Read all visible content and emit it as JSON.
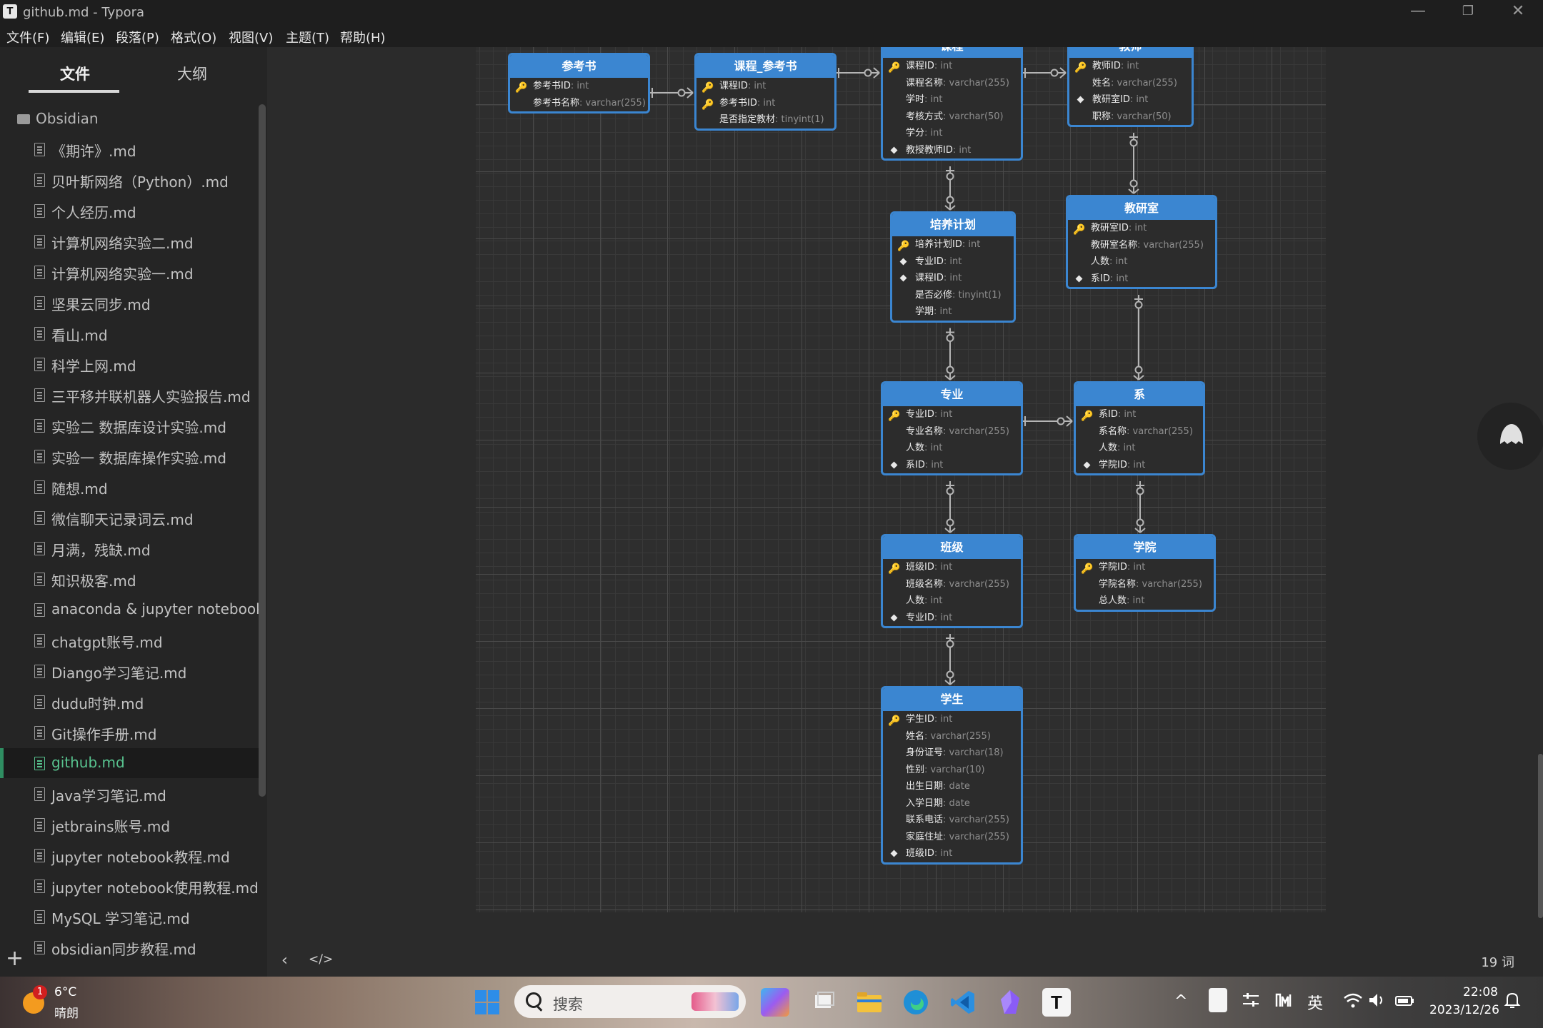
{
  "window": {
    "title": "github.md - Typora",
    "app_icon": "T",
    "minimize": "—",
    "restore": "❐",
    "close": "✕"
  },
  "menu": [
    "文件(F)",
    "编辑(E)",
    "段落(P)",
    "格式(O)",
    "视图(V)",
    "主题(T)",
    "帮助(H)"
  ],
  "sidebar": {
    "tabs": {
      "files": "文件",
      "outline": "大纲"
    },
    "folder": "Obsidian",
    "files": [
      "《期许》.md",
      "贝叶斯网络（Python）.md",
      "个人经历.md",
      "计算机网络实验二.md",
      "计算机网络实验一.md",
      "坚果云同步.md",
      "看山.md",
      "科学上网.md",
      "三平移并联机器人实验报告.md",
      "实验二 数据库设计实验.md",
      "实验一 数据库操作实验.md",
      "随想.md",
      "微信聊天记录词云.md",
      "月满，残缺.md",
      "知识极客.md",
      "anaconda & jupyter notebook",
      "chatgpt账号.md",
      "Diango学习笔记.md",
      "dudu时钟.md",
      "Git操作手册.md",
      "github.md",
      "Java学习笔记.md",
      "jetbrains账号.md",
      "jupyter notebook教程.md",
      "jupyter notebook使用教程.md",
      "MySQL 学习笔记.md",
      "obsidian同步教程.md"
    ],
    "active_file": "github.md",
    "add_button": "+"
  },
  "diagram": {
    "entities": [
      {
        "id": "reference-book",
        "title": "参考书",
        "attrs": [
          {
            "name": "参考书ID",
            "type": "int",
            "key": "pk"
          },
          {
            "name": "参考书名称",
            "type": "varchar(255)",
            "key": ""
          }
        ]
      },
      {
        "id": "course-reference",
        "title": "课程_参考书",
        "attrs": [
          {
            "name": "课程ID",
            "type": "int",
            "key": "pk"
          },
          {
            "name": "参考书ID",
            "type": "int",
            "key": "pk"
          },
          {
            "name": "是否指定教材",
            "type": "tinyint(1)",
            "key": ""
          }
        ]
      },
      {
        "id": "course",
        "title": "课程",
        "attrs": [
          {
            "name": "课程ID",
            "type": "int",
            "key": "pk"
          },
          {
            "name": "课程名称",
            "type": "varchar(255)",
            "key": ""
          },
          {
            "name": "学时",
            "type": "int",
            "key": ""
          },
          {
            "name": "考核方式",
            "type": "varchar(50)",
            "key": ""
          },
          {
            "name": "学分",
            "type": "int",
            "key": ""
          },
          {
            "name": "教授教师ID",
            "type": "int",
            "key": "fk"
          }
        ]
      },
      {
        "id": "teacher",
        "title": "教师",
        "attrs": [
          {
            "name": "教师ID",
            "type": "int",
            "key": "pk"
          },
          {
            "name": "姓名",
            "type": "varchar(255)",
            "key": ""
          },
          {
            "name": "教研室ID",
            "type": "int",
            "key": "fk"
          },
          {
            "name": "职称",
            "type": "varchar(50)",
            "key": ""
          }
        ]
      },
      {
        "id": "training-plan",
        "title": "培养计划",
        "attrs": [
          {
            "name": "培养计划ID",
            "type": "int",
            "key": "pk"
          },
          {
            "name": "专业ID",
            "type": "int",
            "key": "fk"
          },
          {
            "name": "课程ID",
            "type": "int",
            "key": "fk"
          },
          {
            "name": "是否必修",
            "type": "tinyint(1)",
            "key": ""
          },
          {
            "name": "学期",
            "type": "int",
            "key": ""
          }
        ]
      },
      {
        "id": "teaching-office",
        "title": "教研室",
        "attrs": [
          {
            "name": "教研室ID",
            "type": "int",
            "key": "pk"
          },
          {
            "name": "教研室名称",
            "type": "varchar(255)",
            "key": ""
          },
          {
            "name": "人数",
            "type": "int",
            "key": ""
          },
          {
            "name": "系ID",
            "type": "int",
            "key": "fk"
          }
        ]
      },
      {
        "id": "major",
        "title": "专业",
        "attrs": [
          {
            "name": "专业ID",
            "type": "int",
            "key": "pk"
          },
          {
            "name": "专业名称",
            "type": "varchar(255)",
            "key": ""
          },
          {
            "name": "人数",
            "type": "int",
            "key": ""
          },
          {
            "name": "系ID",
            "type": "int",
            "key": "fk"
          }
        ]
      },
      {
        "id": "department",
        "title": "系",
        "attrs": [
          {
            "name": "系ID",
            "type": "int",
            "key": "pk"
          },
          {
            "name": "系名称",
            "type": "varchar(255)",
            "key": ""
          },
          {
            "name": "人数",
            "type": "int",
            "key": ""
          },
          {
            "name": "学院ID",
            "type": "int",
            "key": "fk"
          }
        ]
      },
      {
        "id": "class",
        "title": "班级",
        "attrs": [
          {
            "name": "班级ID",
            "type": "int",
            "key": "pk"
          },
          {
            "name": "班级名称",
            "type": "varchar(255)",
            "key": ""
          },
          {
            "name": "人数",
            "type": "int",
            "key": ""
          },
          {
            "name": "专业ID",
            "type": "int",
            "key": "fk"
          }
        ]
      },
      {
        "id": "college",
        "title": "学院",
        "attrs": [
          {
            "name": "学院ID",
            "type": "int",
            "key": "pk"
          },
          {
            "name": "学院名称",
            "type": "varchar(255)",
            "key": ""
          },
          {
            "name": "总人数",
            "type": "int",
            "key": ""
          }
        ]
      },
      {
        "id": "student",
        "title": "学生",
        "attrs": [
          {
            "name": "学生ID",
            "type": "int",
            "key": "pk"
          },
          {
            "name": "姓名",
            "type": "varchar(255)",
            "key": ""
          },
          {
            "name": "身份证号",
            "type": "varchar(18)",
            "key": ""
          },
          {
            "name": "性别",
            "type": "varchar(10)",
            "key": ""
          },
          {
            "name": "出生日期",
            "type": "date",
            "key": ""
          },
          {
            "name": "入学日期",
            "type": "date",
            "key": ""
          },
          {
            "name": "联系电话",
            "type": "varchar(255)",
            "key": ""
          },
          {
            "name": "家庭住址",
            "type": "varchar(255)",
            "key": ""
          },
          {
            "name": "班级ID",
            "type": "int",
            "key": "fk"
          }
        ]
      }
    ],
    "relationships": [
      {
        "from": "reference-book",
        "to": "course-reference"
      },
      {
        "from": "course-reference",
        "to": "course"
      },
      {
        "from": "course",
        "to": "teacher"
      },
      {
        "from": "course",
        "to": "training-plan"
      },
      {
        "from": "teacher",
        "to": "teaching-office"
      },
      {
        "from": "training-plan",
        "to": "major"
      },
      {
        "from": "teaching-office",
        "to": "department"
      },
      {
        "from": "major",
        "to": "department"
      },
      {
        "from": "major",
        "to": "class"
      },
      {
        "from": "department",
        "to": "college"
      },
      {
        "from": "class",
        "to": "student"
      }
    ]
  },
  "status": {
    "word_count": "19 词",
    "collapse": "‹",
    "source_mode": "</>"
  },
  "taskbar": {
    "weather": {
      "badge": "1",
      "temp": "6°C",
      "desc": "晴朗"
    },
    "search_placeholder": "搜索",
    "apps": [
      "start",
      "copilot",
      "task-view",
      "file-explorer",
      "edge",
      "vscode",
      "obsidian",
      "typora"
    ],
    "tray": {
      "chevron": "^",
      "ime": "英",
      "time": "22:08",
      "date": "2023/12/26"
    }
  },
  "colors": {
    "accent": "#3b86d1",
    "active_file": "#58c38f",
    "key": "#f2c200"
  }
}
